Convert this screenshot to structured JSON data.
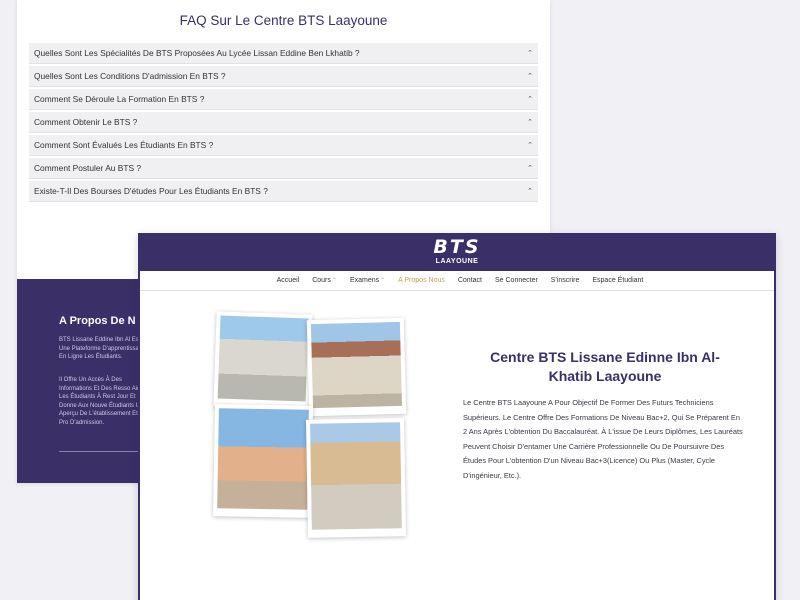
{
  "faq": {
    "title": "FAQ Sur Le Centre BTS Laayoune",
    "items": [
      "Quelles Sont Les Spécialités De BTS Proposées Au Lycée Lissan Eddine Ben Lkhatib ?",
      "Quelles Sont Les Conditions D'admission En BTS ?",
      "Comment Se Déroule La Formation En BTS ?",
      "Comment Obtenir Le BTS ?",
      "Comment Sont Évalués Les Étudiants En BTS ?",
      "Comment Postuler Au BTS ?",
      "Existe-T-Il Des Bourses D'études Pour Les Étudiants En BTS ?"
    ],
    "chevron": "⌃"
  },
  "footer": {
    "about_title": "A Propos De N",
    "about_p1": "BTS Lissane Eddine Ibn Al Est Une Plateforme D'apprentissage En Ligne Les Étudiants.",
    "about_p2": "Il Offre Un Accès À Des Informations Et Des Resso Aide Les Étudiants À Rest Jour Et Donne Aux Nouve Étudiants Un Aperçu De L'établissement Et Du Pro D'admission."
  },
  "header": {
    "logo_main": "BTS",
    "logo_sub": "LAAYOUNE"
  },
  "nav": {
    "items": [
      {
        "label": "Accueil",
        "active": false,
        "dropdown": false
      },
      {
        "label": "Cours",
        "active": false,
        "dropdown": true
      },
      {
        "label": "Examens",
        "active": false,
        "dropdown": true
      },
      {
        "label": "A Propos Nous",
        "active": true,
        "dropdown": false
      },
      {
        "label": "Contact",
        "active": false,
        "dropdown": false
      },
      {
        "label": "Se Connecter",
        "active": false,
        "dropdown": false
      },
      {
        "label": "S'inscrire",
        "active": false,
        "dropdown": false
      },
      {
        "label": "Espace Étudiant",
        "active": false,
        "dropdown": false
      }
    ],
    "caret": "⌃"
  },
  "hero": {
    "title": "Centre BTS Lissane Edinne Ibn Al-Khatib Laayoune",
    "description": "Le Centre BTS Laayoune A Pour Objectif De Former Des Futurs Techniciens Supérieurs. Le Centre Offre Des Formations De Niveau Bac+2, Qui Se Préparent En 2 Ans Après L'obtention Du Baccalauréat. À L'issue De Leurs Diplômes, Les Lauréats Peuvent Choisir D'entamer Une Carrière Professionnelle Ou De Poursuivre Des Études Pour L'obtention D'un Niveau Bac+3(Licence) Ou Plus (Master, Cycle D'ingénieur, Etc.)."
  },
  "colors": {
    "brand_purple": "#3a2f66",
    "accent_gold": "#c8a15a",
    "page_bg": "#f1f0f5"
  }
}
